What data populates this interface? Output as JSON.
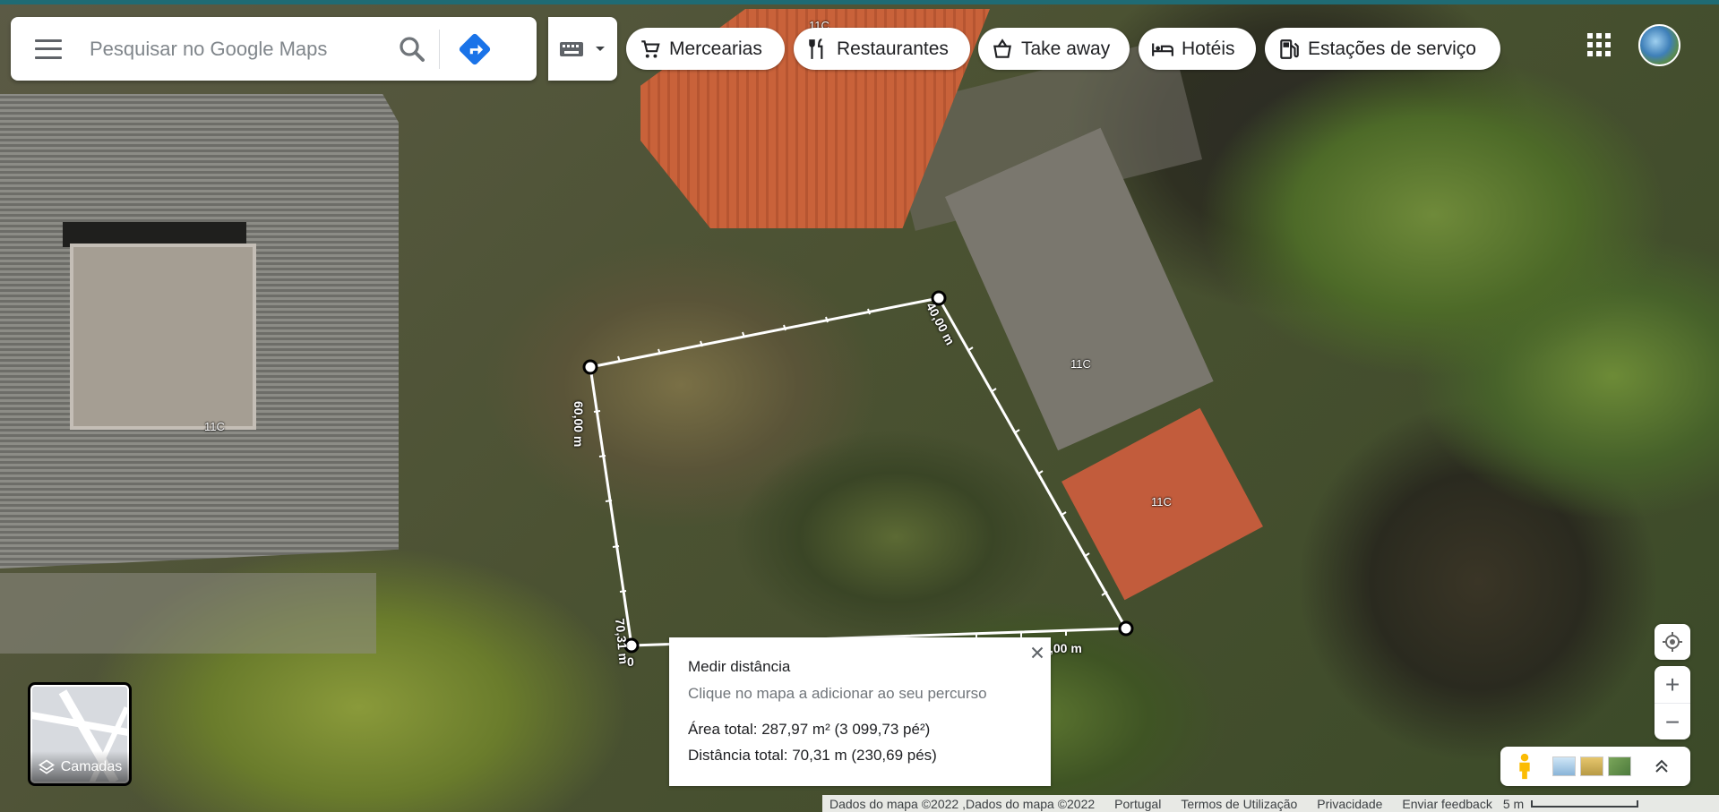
{
  "search": {
    "placeholder": "Pesquisar no Google Maps"
  },
  "chips": [
    {
      "label": "Mercearias",
      "icon": "cart-icon"
    },
    {
      "label": "Restaurantes",
      "icon": "restaurant-icon"
    },
    {
      "label": "Take away",
      "icon": "takeaway-icon"
    },
    {
      "label": "Hotéis",
      "icon": "hotel-icon"
    },
    {
      "label": "Estações de serviço",
      "icon": "gas-station-icon"
    }
  ],
  "map_labels": [
    "11C",
    "11C",
    "11C",
    "11C"
  ],
  "measure_labels": {
    "seg1": "40,00 m",
    "seg2": "60,00 m",
    "seg3": "70,31 m",
    "seg4": ",00 m",
    "start": "0"
  },
  "layers": {
    "label": "Camadas"
  },
  "info": {
    "title": "Medir distância",
    "hint": "Clique no mapa a adicionar ao seu percurso",
    "area": "Área total: 287,97 m² (3 099,73 pé²)",
    "distance": "Distância total: 70,31 m (230,69 pés)"
  },
  "zoom": {
    "in": "+",
    "out": "−"
  },
  "footer": {
    "data": "Dados do mapa ©2022 ,Dados do mapa ©2022",
    "country": "Portugal",
    "terms": "Termos de Utilização",
    "privacy": "Privacidade",
    "feedback": "Enviar feedback",
    "scale": "5 m"
  },
  "colors": {
    "accent": "#1a73e8",
    "top_line": "#1f6b74"
  }
}
